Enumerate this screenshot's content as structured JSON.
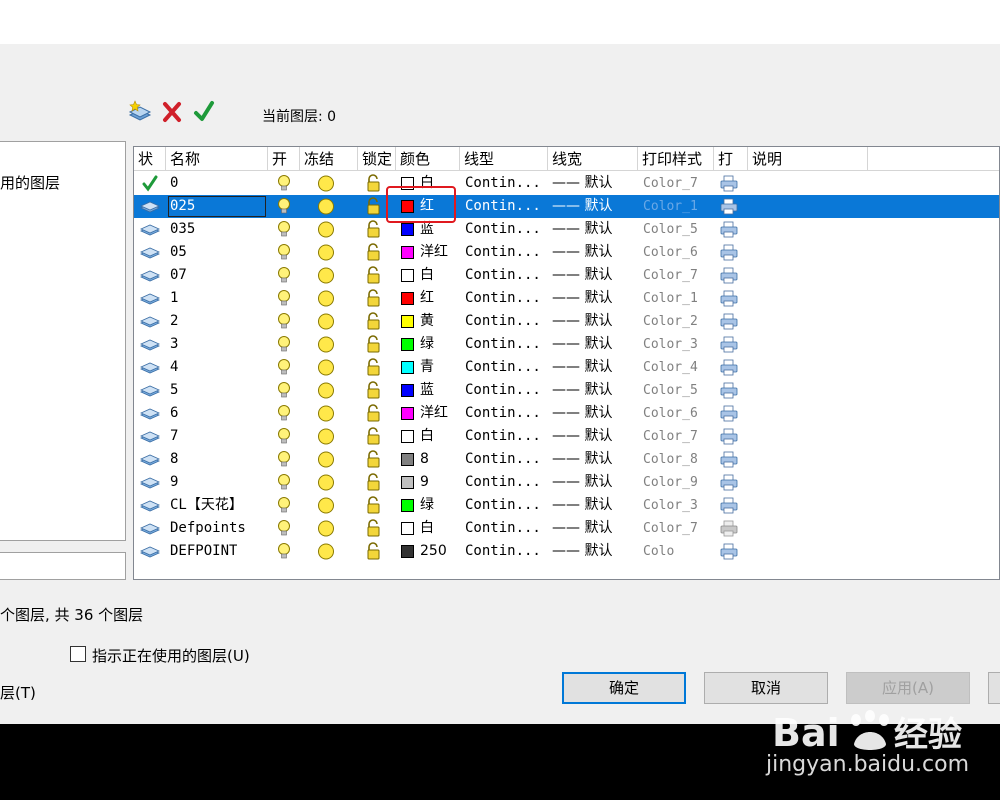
{
  "toolbar": {
    "current_layer_label": "当前图层: 0",
    "icons": [
      "new-layer-icon",
      "delete-layer-icon",
      "set-current-icon"
    ]
  },
  "tree": {
    "label": "用的图层"
  },
  "columns": [
    "状",
    "名称",
    "开",
    "冻结",
    "锁定",
    "颜色",
    "线型",
    "线宽",
    "打印样式",
    "打",
    "说明"
  ],
  "layers": [
    {
      "name": "0",
      "color_name": "白",
      "color": "#ffffff",
      "linetype": "Contin...",
      "lineweight": "—— 默认",
      "plot_style": "Color_7",
      "current": true,
      "selected": false,
      "plot": true
    },
    {
      "name": "025",
      "color_name": "红",
      "color": "#ff0000",
      "linetype": "Contin...",
      "lineweight": "—— 默认",
      "plot_style": "Color_1",
      "current": false,
      "selected": true,
      "plot": true
    },
    {
      "name": "035",
      "color_name": "蓝",
      "color": "#0000ff",
      "linetype": "Contin...",
      "lineweight": "—— 默认",
      "plot_style": "Color_5",
      "current": false,
      "selected": false,
      "plot": true
    },
    {
      "name": "05",
      "color_name": "洋红",
      "color": "#ff00ff",
      "linetype": "Contin...",
      "lineweight": "—— 默认",
      "plot_style": "Color_6",
      "current": false,
      "selected": false,
      "plot": true
    },
    {
      "name": "07",
      "color_name": "白",
      "color": "#ffffff",
      "linetype": "Contin...",
      "lineweight": "—— 默认",
      "plot_style": "Color_7",
      "current": false,
      "selected": false,
      "plot": true
    },
    {
      "name": "1",
      "color_name": "红",
      "color": "#ff0000",
      "linetype": "Contin...",
      "lineweight": "—— 默认",
      "plot_style": "Color_1",
      "current": false,
      "selected": false,
      "plot": true
    },
    {
      "name": "2",
      "color_name": "黄",
      "color": "#ffff00",
      "linetype": "Contin...",
      "lineweight": "—— 默认",
      "plot_style": "Color_2",
      "current": false,
      "selected": false,
      "plot": true
    },
    {
      "name": "3",
      "color_name": "绿",
      "color": "#00ff00",
      "linetype": "Contin...",
      "lineweight": "—— 默认",
      "plot_style": "Color_3",
      "current": false,
      "selected": false,
      "plot": true
    },
    {
      "name": "4",
      "color_name": "青",
      "color": "#00ffff",
      "linetype": "Contin...",
      "lineweight": "—— 默认",
      "plot_style": "Color_4",
      "current": false,
      "selected": false,
      "plot": true
    },
    {
      "name": "5",
      "color_name": "蓝",
      "color": "#0000ff",
      "linetype": "Contin...",
      "lineweight": "—— 默认",
      "plot_style": "Color_5",
      "current": false,
      "selected": false,
      "plot": true
    },
    {
      "name": "6",
      "color_name": "洋红",
      "color": "#ff00ff",
      "linetype": "Contin...",
      "lineweight": "—— 默认",
      "plot_style": "Color_6",
      "current": false,
      "selected": false,
      "plot": true
    },
    {
      "name": "7",
      "color_name": "白",
      "color": "#ffffff",
      "linetype": "Contin...",
      "lineweight": "—— 默认",
      "plot_style": "Color_7",
      "current": false,
      "selected": false,
      "plot": true
    },
    {
      "name": "8",
      "color_name": "8",
      "color": "#808080",
      "linetype": "Contin...",
      "lineweight": "—— 默认",
      "plot_style": "Color_8",
      "current": false,
      "selected": false,
      "plot": true
    },
    {
      "name": "9",
      "color_name": "9",
      "color": "#c0c0c0",
      "linetype": "Contin...",
      "lineweight": "—— 默认",
      "plot_style": "Color_9",
      "current": false,
      "selected": false,
      "plot": true
    },
    {
      "name": "CL【天花】",
      "color_name": "绿",
      "color": "#00ff00",
      "linetype": "Contin...",
      "lineweight": "—— 默认",
      "plot_style": "Color_3",
      "current": false,
      "selected": false,
      "plot": true
    },
    {
      "name": "Defpoints",
      "color_name": "白",
      "color": "#ffffff",
      "linetype": "Contin...",
      "lineweight": "—— 默认",
      "plot_style": "Color_7",
      "current": false,
      "selected": false,
      "plot": false
    },
    {
      "name": "DEFPOINT",
      "color_name": "250",
      "color": "#333333",
      "linetype": "Contin...",
      "lineweight": "—— 默认",
      "plot_style": "Colo",
      "current": false,
      "selected": false,
      "plot": true
    }
  ],
  "status": {
    "text": "个图层, 共 36 个图层"
  },
  "checkbox": {
    "label": "指示正在使用的图层(U)",
    "checked": false
  },
  "fragment_label": "层(T)",
  "buttons": {
    "ok": "确定",
    "cancel": "取消",
    "apply": "应用(A)"
  },
  "watermark": {
    "url": "jingyan.baidu.com"
  }
}
